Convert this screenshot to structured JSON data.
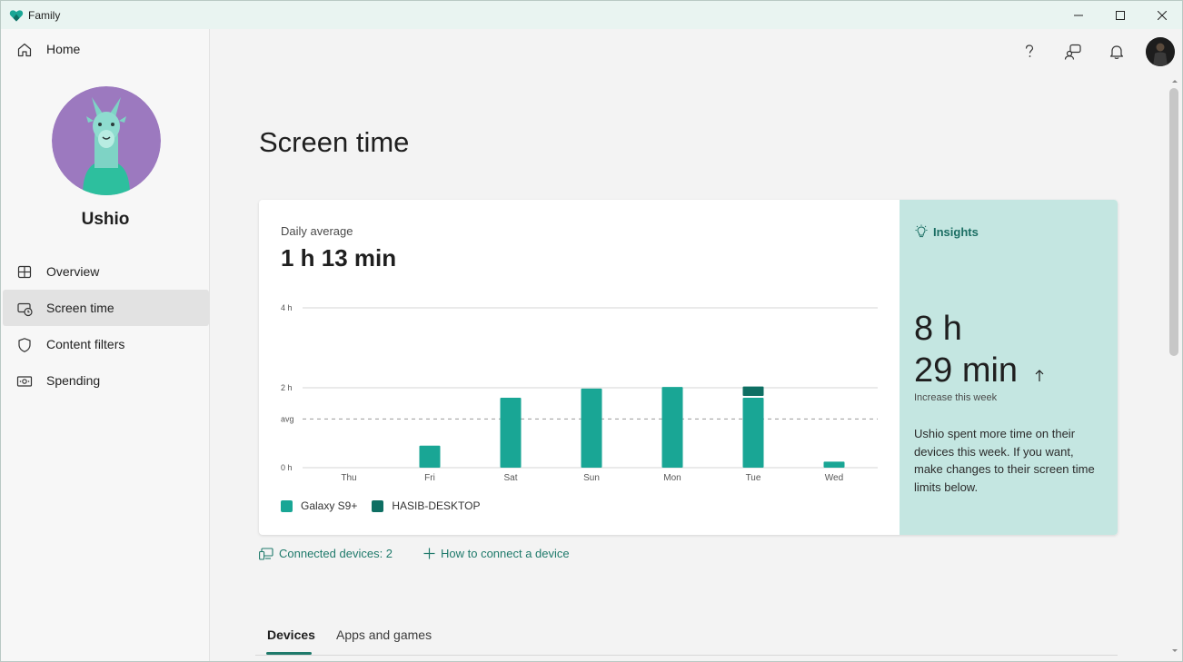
{
  "window": {
    "title": "Family"
  },
  "sidebar": {
    "home_label": "Home",
    "user_name": "Ushio",
    "items": [
      {
        "label": "Overview",
        "icon": "overview-icon"
      },
      {
        "label": "Screen time",
        "icon": "screen-time-icon",
        "active": true
      },
      {
        "label": "Content filters",
        "icon": "shield-icon"
      },
      {
        "label": "Spending",
        "icon": "money-icon"
      }
    ]
  },
  "header": {
    "icons": [
      "help-icon",
      "feedback-icon",
      "bell-icon",
      "profile-avatar"
    ]
  },
  "main": {
    "title": "Screen time",
    "daily_average_label": "Daily average",
    "daily_average_value": "1 h 13 min",
    "insights": {
      "title": "Insights",
      "line1": "8 h",
      "line2": "29 min",
      "sub": "Increase this week",
      "text": "Ushio spent more time on their devices this week. If you want, make changes to their screen time limits below."
    },
    "links": {
      "connected_devices": "Connected devices: 2",
      "how_to_connect": "How to connect a device"
    },
    "tabs": [
      {
        "label": "Devices",
        "active": true
      },
      {
        "label": "Apps and games",
        "active": false
      }
    ]
  },
  "colors": {
    "galaxy": "#19a695",
    "desktop": "#0e6f63",
    "insights_bg": "#c4e6e1",
    "accent": "#1f7a6b"
  },
  "chart_data": {
    "type": "bar",
    "categories": [
      "Thu",
      "Fri",
      "Sat",
      "Sun",
      "Mon",
      "Tue",
      "Wed"
    ],
    "y_ticks": [
      "0 h",
      "avg",
      "2 h",
      "4 h"
    ],
    "ylim": [
      0,
      4
    ],
    "average": 1.22,
    "series": [
      {
        "name": "Galaxy S9+",
        "color": "#19a695",
        "values": [
          0,
          0.55,
          1.75,
          1.98,
          2.02,
          1.75,
          0.15
        ]
      },
      {
        "name": "HASIB-DESKTOP",
        "color": "#0e6f63",
        "values": [
          0,
          0,
          0,
          0,
          0,
          0.28,
          0
        ]
      }
    ]
  }
}
